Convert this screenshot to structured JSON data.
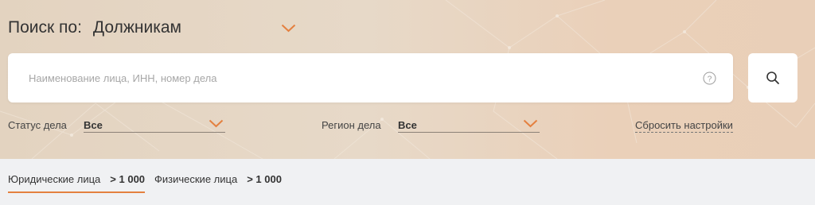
{
  "search": {
    "by_label": "Поиск по:",
    "by_value": "Должникам",
    "placeholder": "Наименование лица, ИНН, номер дела"
  },
  "filters": {
    "status_label": "Статус дела",
    "status_value": "Все",
    "region_label": "Регион дела",
    "region_value": "Все",
    "reset_label": "Сбросить настройки"
  },
  "tabs": [
    {
      "label": "Юридические лица",
      "count": "> 1 000",
      "active": true
    },
    {
      "label": "Физические лица",
      "count": "> 1 000",
      "active": false
    }
  ],
  "icons": {
    "dropdown": "chevron-down-icon",
    "help": "question-circle-icon",
    "search": "magnifier-icon"
  },
  "colors": {
    "accent": "#e4803f",
    "hero_background": "#e6d6c3",
    "page_background": "#f0f1f3"
  }
}
